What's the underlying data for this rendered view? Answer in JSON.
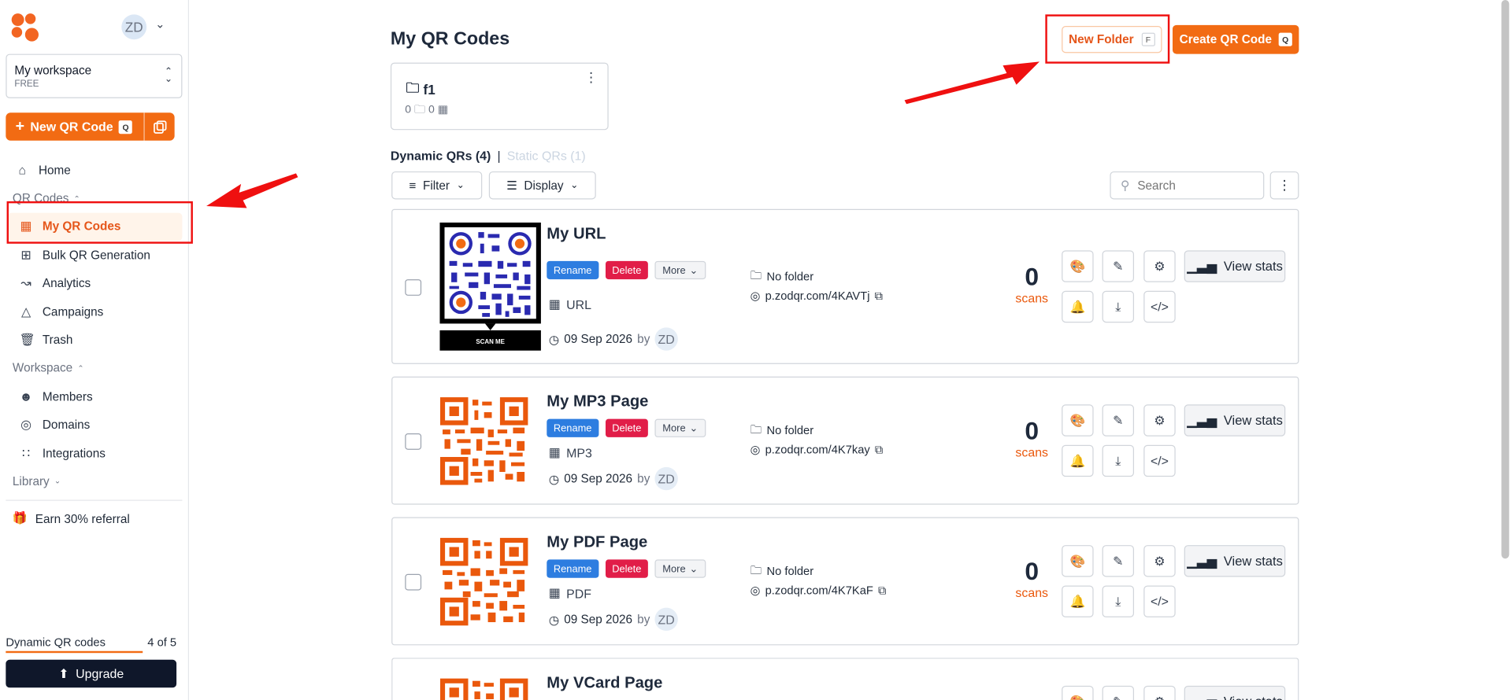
{
  "sidebar": {
    "avatar_initials": "ZD",
    "workspace_name": "My workspace",
    "workspace_plan": "FREE",
    "new_qr_label": "New QR Code",
    "new_qr_shortcut": "Q",
    "nav": {
      "home": "Home",
      "qr_codes_section": "QR Codes",
      "my_qr_codes": "My QR Codes",
      "bulk": "Bulk QR Generation",
      "analytics": "Analytics",
      "campaigns": "Campaigns",
      "trash": "Trash",
      "workspace_section": "Workspace",
      "members": "Members",
      "domains": "Domains",
      "integrations": "Integrations",
      "library_section": "Library"
    },
    "earn_label": "Earn 30% referral",
    "quota_label": "Dynamic QR codes",
    "quota_value": "4 of 5",
    "quota_fraction": 0.8,
    "upgrade_label": "Upgrade"
  },
  "header": {
    "title": "My QR Codes",
    "new_folder_label": "New Folder",
    "new_folder_shortcut": "F",
    "create_label": "Create QR Code",
    "create_shortcut": "Q"
  },
  "folder": {
    "name": "f1",
    "folders_count": "0",
    "qr_count": "0"
  },
  "tabs": {
    "dynamic": "Dynamic QRs (4)",
    "separator": "|",
    "static": "Static QRs (1)"
  },
  "controls": {
    "filter": "Filter",
    "display": "Display",
    "search_placeholder": "Search"
  },
  "card_labels": {
    "rename": "Rename",
    "delete": "Delete",
    "more": "More",
    "by": "by",
    "scans": "scans",
    "view_stats": "View stats",
    "scan_me": "SCAN ME"
  },
  "cards": [
    {
      "title": "My URL",
      "type": "URL",
      "date": "09 Sep 2026",
      "owner": "ZD",
      "folder": "No folder",
      "link": "p.zodqr.com/4KAVTj",
      "scans": "0"
    },
    {
      "title": "My MP3 Page",
      "type": "MP3",
      "date": "09 Sep 2026",
      "owner": "ZD",
      "folder": "No folder",
      "link": "p.zodqr.com/4K7kay",
      "scans": "0"
    },
    {
      "title": "My PDF Page",
      "type": "PDF",
      "date": "09 Sep 2026",
      "owner": "ZD",
      "folder": "No folder",
      "link": "p.zodqr.com/4K7KaF",
      "scans": "0"
    },
    {
      "title": "My VCard Page"
    }
  ],
  "colors": {
    "brand": "#f26b13",
    "active_bg": "#fff4ea",
    "annotation": "#ef1010"
  }
}
